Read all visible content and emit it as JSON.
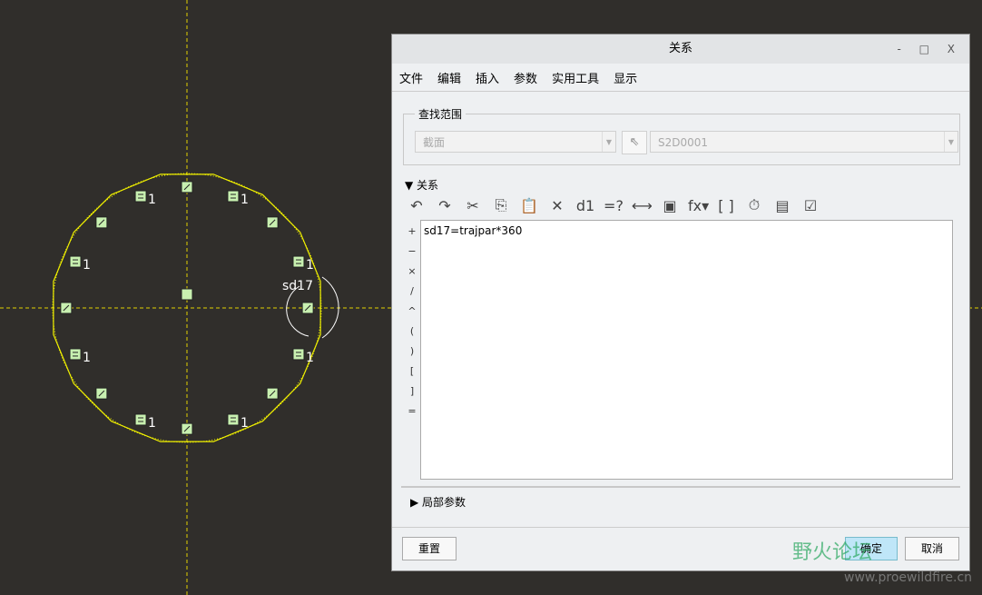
{
  "sketch": {
    "dim_label": "sd17",
    "equal_label": "1",
    "colors": {
      "geom": "#f0f000",
      "marker_bg": "#c8f0b0",
      "axis": "#e0d000"
    }
  },
  "dialog": {
    "title": "关系",
    "window_buttons": "- □ X",
    "menu": [
      "文件",
      "编辑",
      "插入",
      "参数",
      "实用工具",
      "显示"
    ],
    "search_group": {
      "legend": "查找范围",
      "type_value": "截面",
      "object_value": "S2D0001"
    },
    "relations_section": "关系",
    "toolbar": [
      {
        "icon": "undo-icon",
        "glyph": "↶"
      },
      {
        "icon": "redo-icon",
        "glyph": "↷"
      },
      {
        "icon": "cut-icon",
        "glyph": "✂"
      },
      {
        "icon": "copy-icon",
        "glyph": "⎘"
      },
      {
        "icon": "paste-icon",
        "glyph": "📋"
      },
      {
        "icon": "delete-icon",
        "glyph": "✕"
      },
      {
        "icon": "switch-dims-icon",
        "glyph": "d1"
      },
      {
        "icon": "evaluate-icon",
        "glyph": "=?"
      },
      {
        "icon": "insert-dimension-icon",
        "glyph": "⟷"
      },
      {
        "icon": "insert-param-icon",
        "glyph": "▣"
      },
      {
        "icon": "function-icon",
        "glyph": "fx▾"
      },
      {
        "icon": "brackets-icon",
        "glyph": "[ ]"
      },
      {
        "icon": "units-icon",
        "glyph": "⏱"
      },
      {
        "icon": "sort-icon",
        "glyph": "▤"
      },
      {
        "icon": "verify-icon",
        "glyph": "☑"
      }
    ],
    "operators": [
      "+",
      "−",
      "×",
      "/",
      "^",
      "( )",
      "[ ]",
      "="
    ],
    "relation_text": "sd17=trajpar*360",
    "local_params": "局部参数",
    "reset": "重置",
    "ok": "确定",
    "cancel": "取消"
  },
  "watermark": {
    "title": "野火论坛",
    "url": "www.proewildfire.cn"
  }
}
